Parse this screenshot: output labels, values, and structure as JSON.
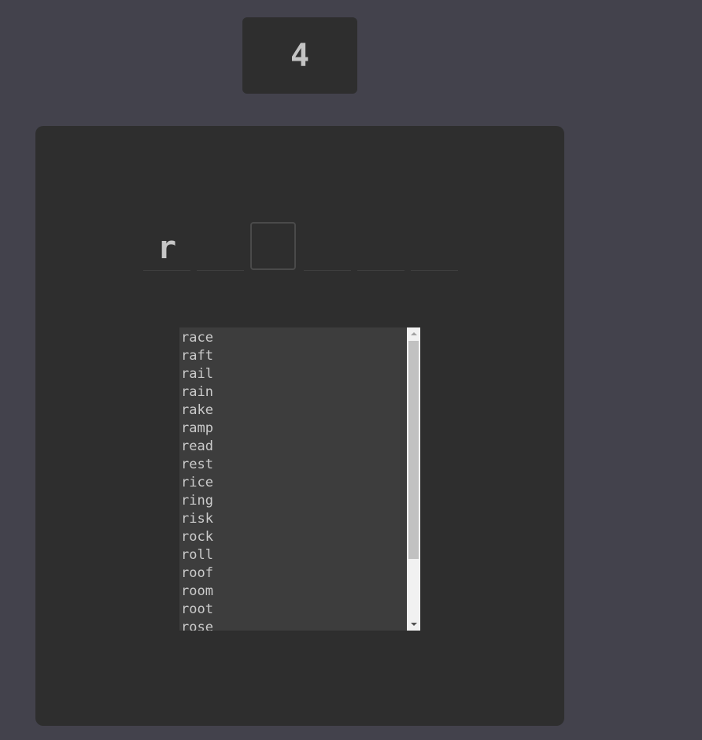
{
  "counter": {
    "value": "4"
  },
  "slots": [
    {
      "letter": "r",
      "active": false
    },
    {
      "letter": "",
      "active": false
    },
    {
      "letter": "",
      "active": true
    },
    {
      "letter": "",
      "active": false
    },
    {
      "letter": "",
      "active": false
    },
    {
      "letter": "",
      "active": false
    }
  ],
  "word_list": [
    "race",
    "raft",
    "rail",
    "rain",
    "rake",
    "ramp",
    "read",
    "rest",
    "rice",
    "ring",
    "risk",
    "rock",
    "roll",
    "roof",
    "room",
    "root",
    "rose"
  ],
  "scrollbar": {
    "position": 0
  },
  "colors": {
    "background": "#43424c",
    "panel": "#2e2e2e",
    "listbox": "#3d3d3d",
    "text": "#cbcbcb"
  }
}
